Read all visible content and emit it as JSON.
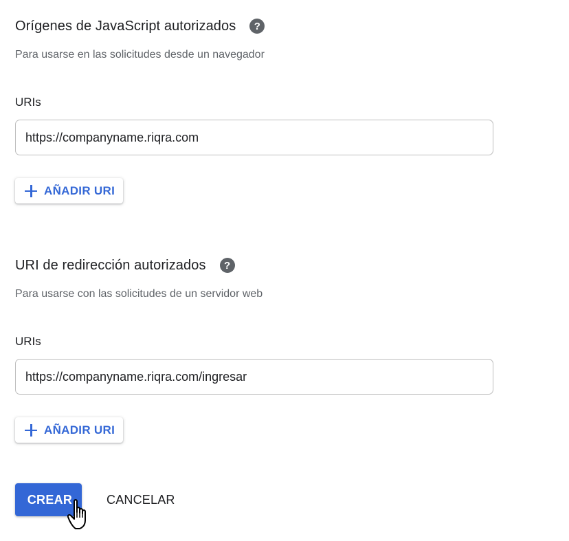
{
  "js_origins": {
    "title": "Orígenes de JavaScript autorizados",
    "help_icon": "help-circle-icon",
    "help_glyph": "?",
    "description": "Para usarse en las solicitudes desde un navegador",
    "uris_label": "URIs",
    "uri_value": "https://companyname.riqra.com",
    "add_uri_label": "AÑADIR URI"
  },
  "redirect_uris": {
    "title": "URI de redirección autorizados",
    "help_icon": "help-circle-icon",
    "help_glyph": "?",
    "description": "Para usarse con las solicitudes de un servidor web",
    "uris_label": "URIs",
    "uri_value": "https://companyname.riqra.com/ingresar",
    "add_uri_label": "AÑADIR URI"
  },
  "actions": {
    "create_label": "CREAR",
    "cancel_label": "CANCELAR"
  },
  "colors": {
    "accent": "#3367d6",
    "text": "#202124",
    "secondary_text": "#5f6368",
    "help_icon_bg": "#5f6368"
  },
  "cursor": "hand-pointer-icon"
}
